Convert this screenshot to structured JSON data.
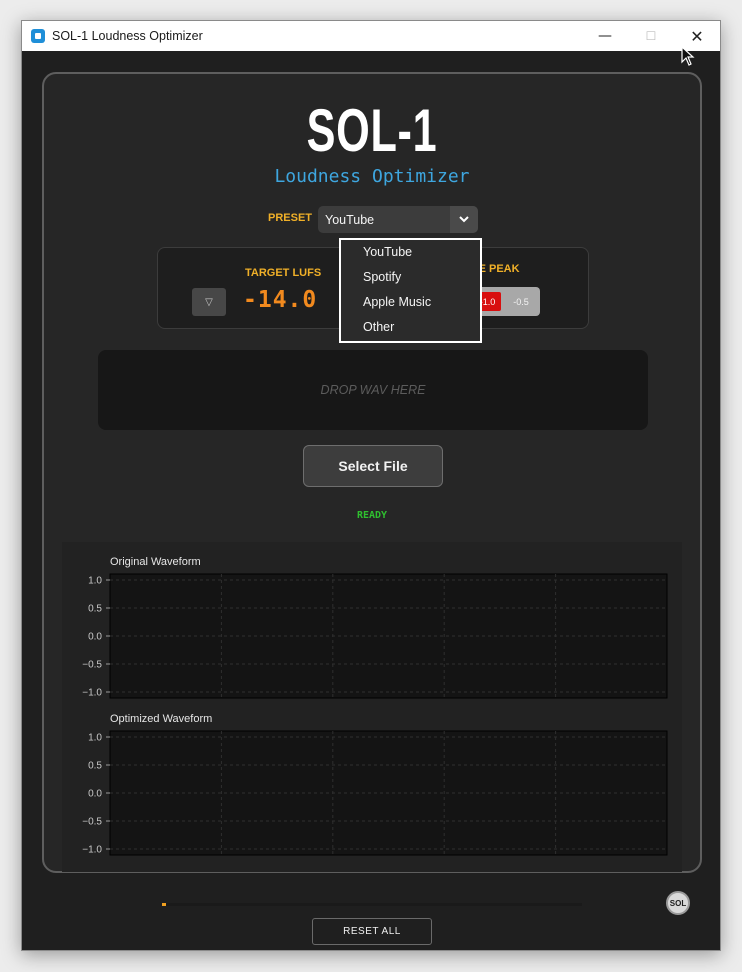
{
  "window": {
    "title": "SOL-1 Loudness Optimizer"
  },
  "header": {
    "logo": "SOL-1",
    "subtitle": "Loudness Optimizer"
  },
  "preset": {
    "label": "PRESET",
    "selected": "YouTube",
    "options": [
      "YouTube",
      "Spotify",
      "Apple Music",
      "Other"
    ],
    "dropdown_open": true
  },
  "target_lufs": {
    "label": "TARGET LUFS",
    "value": "-14.0",
    "down_symbol": "▽"
  },
  "true_peak": {
    "label": "TRUE PEAK",
    "options": [
      "-1.0",
      "-0.5"
    ],
    "selected": "-1.0"
  },
  "drop_zone": {
    "text": "DROP WAV HERE"
  },
  "select_file": {
    "label": "Select File"
  },
  "status": {
    "text": "READY",
    "color": "#2fbf2f"
  },
  "chart_data": [
    {
      "type": "line",
      "title": "Original Waveform",
      "xlabel": "",
      "ylabel": "",
      "yticks": [
        "1.0",
        "0.5",
        "0.0",
        "−0.5",
        "−1.0"
      ],
      "ylim": [
        -1.0,
        1.0
      ],
      "x": [],
      "series": [],
      "grid": true
    },
    {
      "type": "line",
      "title": "Optimized Waveform",
      "xlabel": "",
      "ylabel": "",
      "yticks": [
        "1.0",
        "0.5",
        "0.0",
        "−0.5",
        "−1.0"
      ],
      "ylim": [
        -1.0,
        1.0
      ],
      "x": [],
      "series": [],
      "grid": true
    }
  ],
  "progress": {
    "value": 0.01
  },
  "footer": {
    "seal_text": "SOL",
    "reset_label": "RESET ALL"
  },
  "colors": {
    "accent_orange": "#f28a1e",
    "label_amber": "#f0b028",
    "subtitle_blue": "#3ea6df",
    "true_peak_active": "#d80f0f"
  },
  "icons": {
    "minimize": "minimize-icon",
    "maximize": "maximize-icon",
    "close": "close-icon",
    "dropdown": "chevron-down-icon",
    "pointer": "mouse-pointer-icon"
  }
}
